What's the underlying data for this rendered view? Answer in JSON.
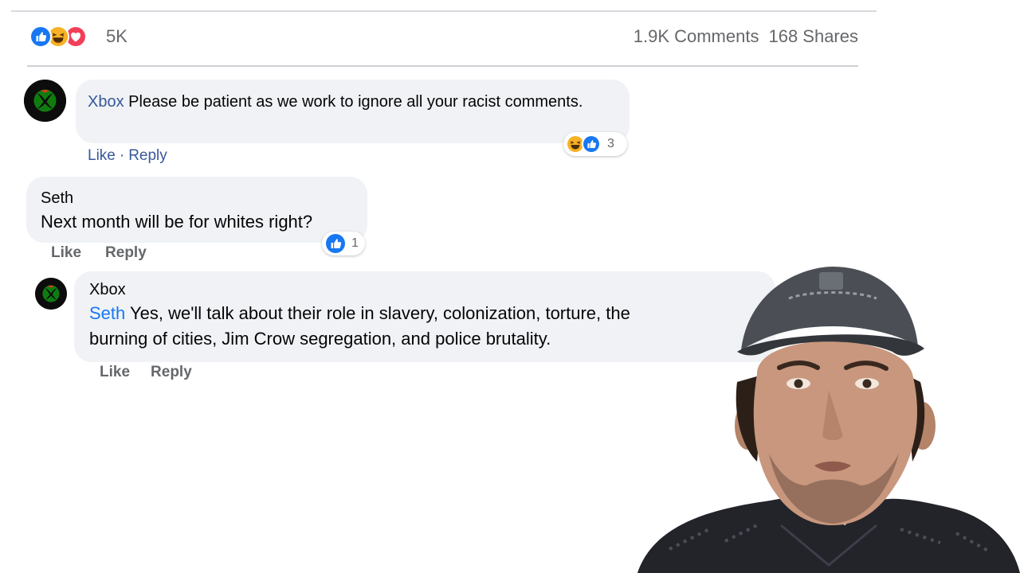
{
  "post_stats": {
    "reaction_total": "5K",
    "reaction_icons": [
      "like-icon",
      "haha-icon",
      "love-icon"
    ],
    "comments": "1.9K Comments",
    "shares": "168 Shares"
  },
  "comments": [
    {
      "author": "Xbox",
      "text": "Please be patient as we work to ignore all your racist comments.",
      "actions": {
        "like": "Like",
        "separator": "·",
        "reply": "Reply"
      },
      "reaction_count": "3",
      "reaction_icons": [
        "haha-icon",
        "like-icon"
      ]
    },
    {
      "author": "Seth",
      "text": "Next month will be for whites right?",
      "actions": {
        "like": "Like",
        "reply": "Reply"
      },
      "reaction_count": "1",
      "reaction_icons": [
        "like-icon"
      ]
    },
    {
      "author": "Xbox",
      "mention": "Seth",
      "text_line1": "Yes, we'll talk about their role in slavery, colonization, torture, the",
      "text_line2": "burning of cities, Jim Crow segregation, and police brutality.",
      "actions": {
        "like": "Like",
        "reply": "Reply"
      }
    }
  ],
  "colors": {
    "link_blue": "#385898",
    "mention_blue": "#1877f2",
    "bubble_gray": "#f0f2f5",
    "meta_gray": "#65676b",
    "xbox_green": "#107c10"
  }
}
